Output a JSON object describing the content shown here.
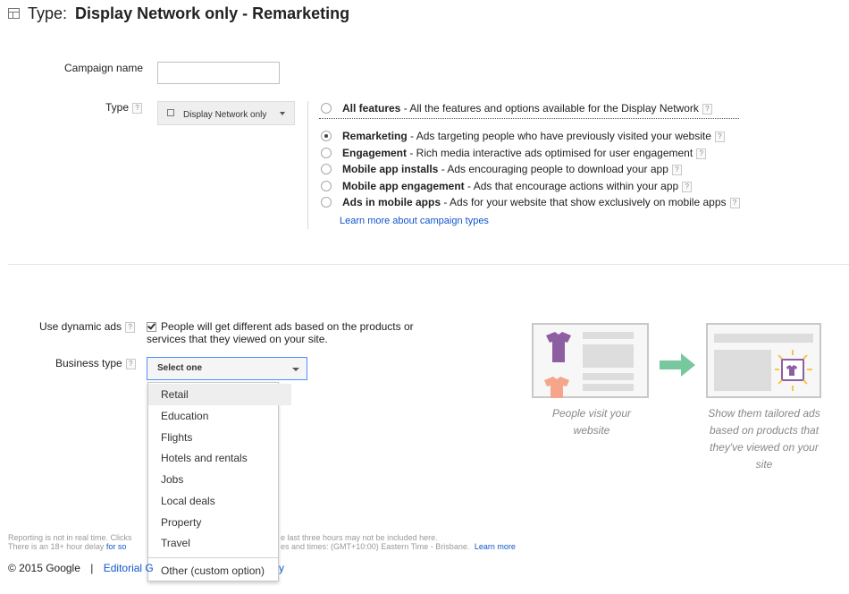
{
  "header": {
    "title_prefix": "Type:",
    "title": "Display Network only - Remarketing"
  },
  "form": {
    "campaign_name_label": "Campaign name",
    "campaign_name_value": "",
    "type_label": "Type",
    "type_button": "Display Network only",
    "help": "?"
  },
  "options": [
    {
      "name": "All features",
      "desc": " - All the features and options available for the Display Network",
      "selected": false
    },
    {
      "name": "Remarketing",
      "desc": " - Ads targeting people who have previously visited your website",
      "selected": true
    },
    {
      "name": "Engagement",
      "desc": " - Rich media interactive ads optimised for user engagement",
      "selected": false
    },
    {
      "name": "Mobile app installs",
      "desc": " - Ads encouraging people to download your app",
      "selected": false
    },
    {
      "name": "Mobile app engagement",
      "desc": " - Ads that encourage actions within your app",
      "selected": false
    },
    {
      "name": "Ads in mobile apps",
      "desc": " - Ads for your website that show exclusively on mobile apps",
      "selected": false
    }
  ],
  "learn_more_types": "Learn more about campaign types",
  "dynamic": {
    "label": "Use dynamic ads",
    "checkbox_text": "People will get different ads based on the products or services that they viewed on your site.",
    "checked": true
  },
  "business": {
    "label": "Business type",
    "select_value": "Select one",
    "menu": [
      "Retail",
      "Education",
      "Flights",
      "Hotels and rentals",
      "Jobs",
      "Local deals",
      "Property",
      "Travel"
    ],
    "menu_other": "Other (custom option)",
    "highlighted": "Retail"
  },
  "illustration": {
    "left_caption": "People visit your website",
    "right_caption": "Show them tailored ads based on products that they've viewed on your site"
  },
  "footer": {
    "line1_a": "Reporting is not in real time. Clicks",
    "line1_b": "e last three hours may not be included here.",
    "line2_a": "There is an 18+ hour delay ",
    "line2_link": "for so",
    "line2_b": "es and times: (GMT+10:00) Eastern Time - Brisbane.",
    "learn_more": "Learn more",
    "copyright": "© 2015 Google",
    "separator": "|",
    "editorial": "Editorial G",
    "tail": "y"
  },
  "colors": {
    "link": "#1155cc",
    "purple": "#8e5ea2",
    "salmon": "#f4a58a",
    "arrow": "#77c89e",
    "spark": "#f5c84a"
  }
}
